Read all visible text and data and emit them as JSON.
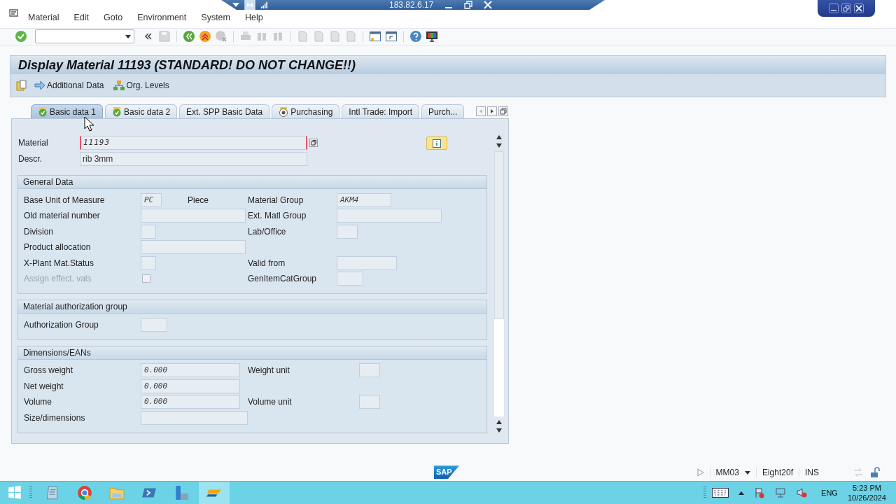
{
  "menu": [
    "Material",
    "Edit",
    "Goto",
    "Environment",
    "System",
    "Help"
  ],
  "remote_bar": {
    "address": "183.82.6.17"
  },
  "title": "Display Material 11193 (STANDARD! DO NOT CHANGE!!)",
  "app_toolbar": [
    {
      "label": "Additional Data",
      "kind": "arrow"
    },
    {
      "label": "Org. Levels",
      "kind": "hierarchy"
    }
  ],
  "tabs": [
    {
      "label": "Basic data 1",
      "selected": true,
      "kind": "checked"
    },
    {
      "label": "Basic data 2",
      "selected": false,
      "kind": "checked"
    },
    {
      "label": "Ext. SPP Basic Data",
      "selected": false,
      "kind": "plain"
    },
    {
      "label": "Purchasing",
      "selected": false,
      "kind": "target"
    },
    {
      "label": "Intl Trade: Import",
      "selected": false,
      "kind": "plain"
    },
    {
      "label": "Purch...",
      "selected": false,
      "kind": "plain"
    }
  ],
  "header_fields": [
    {
      "label": "Material",
      "value": "11193",
      "kind": "key"
    },
    {
      "label": "Descr.",
      "value": "rib 3mm",
      "kind": "text"
    }
  ],
  "sections": [
    {
      "title": "General Data",
      "rows": [
        {
          "left": {
            "label": "Base Unit of Measure",
            "field": {
              "kind": "input",
              "value": "PC"
            },
            "note": "Piece"
          },
          "right": {
            "label": "Material Group",
            "field": {
              "kind": "input",
              "value": "AKM4"
            }
          }
        },
        {
          "left": {
            "label": "Old material number",
            "field": {
              "kind": "input"
            }
          },
          "right": {
            "label": "Ext. Matl Group",
            "field": {
              "kind": "input"
            }
          }
        },
        {
          "left": {
            "label": "Division",
            "field": {
              "kind": "input"
            }
          },
          "right": {
            "label": "Lab/Office",
            "field": {
              "kind": "input"
            }
          }
        },
        {
          "left": {
            "label": "Product allocation",
            "field": {
              "kind": "input"
            }
          }
        },
        {
          "left": {
            "label": "X-Plant Mat.Status",
            "field": {
              "kind": "input"
            }
          },
          "right": {
            "label": "Valid from",
            "field": {
              "kind": "input"
            }
          }
        },
        {
          "left": {
            "label": "Assign effect. vals",
            "disabled": true,
            "field": {
              "kind": "checkbox",
              "checked": false
            }
          },
          "right": {
            "label": "GenItemCatGroup",
            "field": {
              "kind": "input"
            }
          }
        }
      ]
    },
    {
      "title": "Material authorization group",
      "rows": [
        {
          "left": {
            "label": "Authorization Group",
            "field": {
              "kind": "input"
            }
          }
        }
      ]
    },
    {
      "title": "Dimensions/EANs",
      "rows": [
        {
          "left": {
            "label": "Gross weight",
            "field": {
              "kind": "input",
              "value": "0.000"
            }
          },
          "right": {
            "label": "Weight unit",
            "field": {
              "kind": "input"
            }
          }
        },
        {
          "left": {
            "label": "Net weight",
            "field": {
              "kind": "input",
              "value": "0.000"
            }
          }
        },
        {
          "left": {
            "label": "Volume",
            "field": {
              "kind": "input",
              "value": "0.000"
            }
          },
          "right": {
            "label": "Volume unit",
            "field": {
              "kind": "input"
            }
          }
        },
        {
          "left": {
            "label": "Size/dimensions",
            "field": {
              "kind": "input"
            }
          }
        }
      ]
    }
  ],
  "status_bar": {
    "logo": "SAP",
    "transaction": "MM03",
    "server": "Eight20f",
    "mode": "INS"
  },
  "taskbar": {
    "language": "ENG",
    "time": "5:23 PM",
    "date": "10/26/2024"
  }
}
